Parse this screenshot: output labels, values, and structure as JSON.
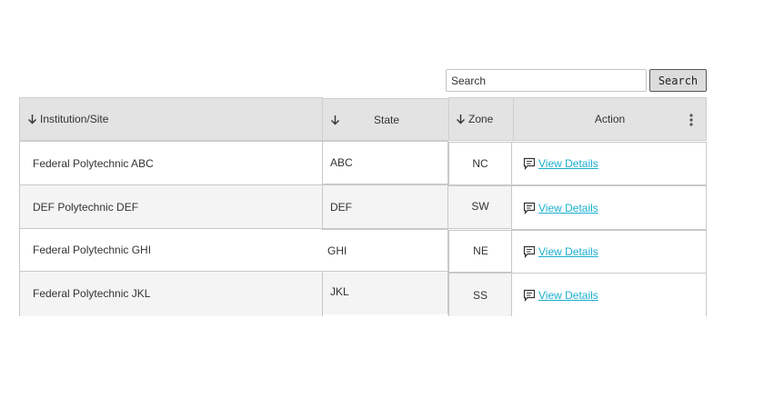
{
  "search": {
    "placeholder": "Search",
    "button_label": "Search"
  },
  "table": {
    "headers": {
      "institution": "Institution/Site",
      "state": "State",
      "zone": "Zone",
      "action": "Action"
    },
    "rows": [
      {
        "institution": "Federal Polytechnic ABC",
        "state": "ABC",
        "zone": "NC",
        "action": "View Details"
      },
      {
        "institution": "DEF  Polytechnic DEF",
        "state": "DEF",
        "zone": "SW",
        "action": "View Details"
      },
      {
        "institution": "Federal Polytechnic GHI",
        "state": "GHI",
        "zone": "NE",
        "action": "View Details"
      },
      {
        "institution": "Federal Polytechnic JKL",
        "state": "JKL",
        "zone": "SS",
        "action": "View Details"
      }
    ]
  },
  "icons": {
    "sort": "arrow-down-icon",
    "menu": "more-vertical-icon",
    "details": "comment-icon"
  }
}
